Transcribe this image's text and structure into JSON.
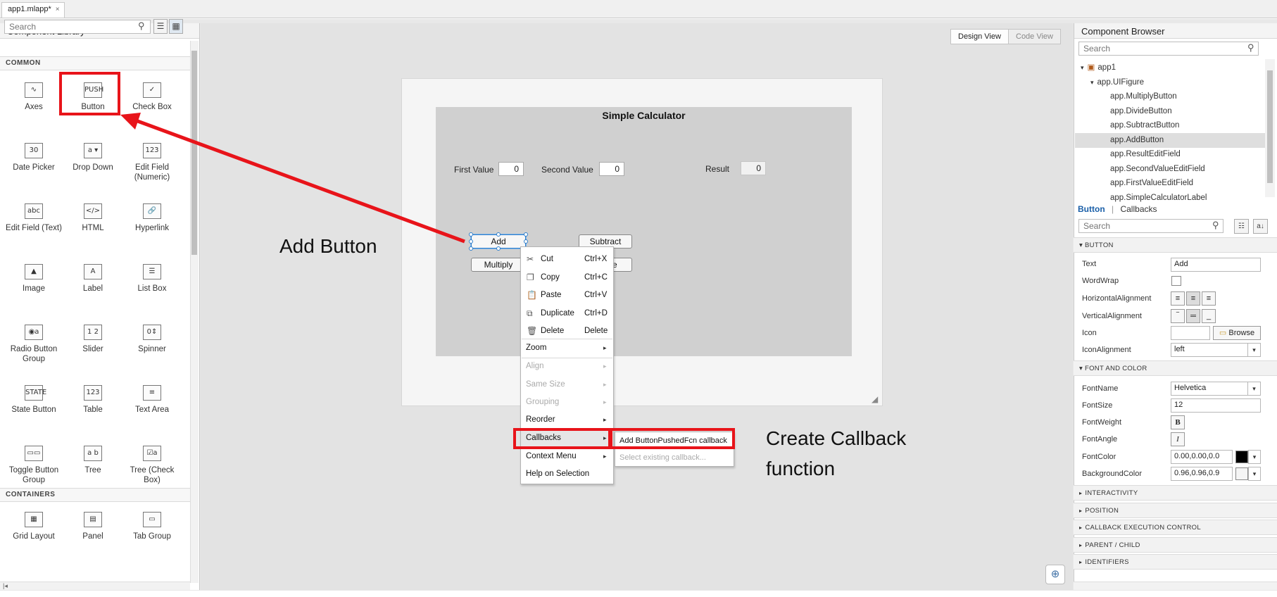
{
  "tab": {
    "label": "app1.mlapp*",
    "close": "×"
  },
  "library": {
    "title": "Component Library",
    "search_placeholder": "Search",
    "sections": {
      "common": "COMMON",
      "containers": "CONTAINERS"
    },
    "common": [
      {
        "label": "Axes",
        "icon": "∿",
        "icon_name": "axes-icon"
      },
      {
        "label": "Button",
        "icon": "PUSH",
        "icon_name": "push-button-icon"
      },
      {
        "label": "Check Box",
        "icon": "✓",
        "icon_name": "checkbox-icon"
      },
      {
        "label": "Date Picker",
        "icon": "30",
        "icon_name": "calendar-icon"
      },
      {
        "label": "Drop Down",
        "icon": "a ▾",
        "icon_name": "dropdown-icon"
      },
      {
        "label": "Edit Field (Numeric)",
        "icon": "123",
        "icon_name": "numeric-field-icon"
      },
      {
        "label": "Edit Field (Text)",
        "icon": "abc",
        "icon_name": "text-field-icon"
      },
      {
        "label": "HTML",
        "icon": "</>",
        "icon_name": "html-icon"
      },
      {
        "label": "Hyperlink",
        "icon": "🔗",
        "icon_name": "hyperlink-icon"
      },
      {
        "label": "Image",
        "icon": "▲",
        "icon_name": "image-icon"
      },
      {
        "label": "Label",
        "icon": "A",
        "icon_name": "label-icon"
      },
      {
        "label": "List Box",
        "icon": "☰",
        "icon_name": "listbox-icon"
      },
      {
        "label": "Radio Button Group",
        "icon": "◉a",
        "icon_name": "radio-group-icon"
      },
      {
        "label": "Slider",
        "icon": "1 2",
        "icon_name": "slider-icon"
      },
      {
        "label": "Spinner",
        "icon": "0⇕",
        "icon_name": "spinner-icon"
      },
      {
        "label": "State Button",
        "icon": "STATE",
        "icon_name": "state-button-icon"
      },
      {
        "label": "Table",
        "icon": "123",
        "icon_name": "table-icon"
      },
      {
        "label": "Text Area",
        "icon": "≡",
        "icon_name": "textarea-icon"
      },
      {
        "label": "Toggle Button Group",
        "icon": "▭▭",
        "icon_name": "toggle-group-icon"
      },
      {
        "label": "Tree",
        "icon": "a b",
        "icon_name": "tree-icon"
      },
      {
        "label": "Tree (Check Box)",
        "icon": "☑a",
        "icon_name": "tree-checkbox-icon"
      }
    ],
    "containers": [
      {
        "label": "Grid Layout",
        "icon": "▦",
        "icon_name": "grid-layout-icon"
      },
      {
        "label": "Panel",
        "icon": "▤",
        "icon_name": "panel-icon"
      },
      {
        "label": "Tab Group",
        "icon": "▭",
        "icon_name": "tab-group-icon"
      }
    ]
  },
  "canvas": {
    "design_view": "Design View",
    "code_view": "Code View",
    "figure": {
      "title": "Simple Calculator",
      "first_label": "First Value",
      "first_value": "0",
      "second_label": "Second Value",
      "second_value": "0",
      "result_label": "Result",
      "result_value": "0",
      "buttons": {
        "add": "Add",
        "subtract": "Subtract",
        "multiply": "Multiply",
        "divide": "Divide"
      }
    }
  },
  "context_menu": {
    "items": [
      {
        "label": "Cut",
        "shortcut": "Ctrl+X",
        "icon": "✂"
      },
      {
        "label": "Copy",
        "shortcut": "Ctrl+C",
        "icon": "❐"
      },
      {
        "label": "Paste",
        "shortcut": "Ctrl+V",
        "icon": "📋"
      },
      {
        "label": "Duplicate",
        "shortcut": "Ctrl+D",
        "icon": "⧉"
      },
      {
        "label": "Delete",
        "shortcut": "Delete",
        "icon": "🗑"
      }
    ],
    "zoom": "Zoom",
    "align": "Align",
    "same_size": "Same Size",
    "grouping": "Grouping",
    "reorder": "Reorder",
    "callbacks": "Callbacks",
    "context_menu": "Context Menu",
    "help": "Help on Selection",
    "submenu": {
      "add": "Add ButtonPushedFcn callback",
      "select": "Select existing callback..."
    }
  },
  "annotations": {
    "add_button": "Add Button",
    "create_callback_1": "Create Callback",
    "create_callback_2": "function"
  },
  "browser": {
    "title": "Component Browser",
    "search_placeholder": "Search",
    "tree": [
      {
        "label": "app1",
        "level": 0
      },
      {
        "label": "app.UIFigure",
        "level": 1
      },
      {
        "label": "app.MultiplyButton",
        "level": 2
      },
      {
        "label": "app.DivideButton",
        "level": 2
      },
      {
        "label": "app.SubtractButton",
        "level": 2
      },
      {
        "label": "app.AddButton",
        "level": 2,
        "selected": true
      },
      {
        "label": "app.ResultEditField",
        "level": 2
      },
      {
        "label": "app.SecondValueEditField",
        "level": 2
      },
      {
        "label": "app.FirstValueEditField",
        "level": 2
      },
      {
        "label": "app.SimpleCalculatorLabel",
        "level": 2
      }
    ]
  },
  "inspector": {
    "tab_button": "Button",
    "tab_callbacks": "Callbacks",
    "search_placeholder": "Search",
    "button_section": "BUTTON",
    "font_section": "FONT AND COLOR",
    "props": {
      "text_label": "Text",
      "text_value": "Add",
      "wordwrap_label": "WordWrap",
      "halign_label": "HorizontalAlignment",
      "valign_label": "VerticalAlignment",
      "icon_label": "Icon",
      "browse": "Browse",
      "iconalign_label": "IconAlignment",
      "iconalign_value": "left",
      "fontname_label": "FontName",
      "fontname_value": "Helvetica",
      "fontsize_label": "FontSize",
      "fontsize_value": "12",
      "fontweight_label": "FontWeight",
      "bold": "B",
      "fontangle_label": "FontAngle",
      "italic": "I",
      "fontcolor_label": "FontColor",
      "fontcolor_value": "0.00,0.00,0.0",
      "bgcolor_label": "BackgroundColor",
      "bgcolor_value": "0.96,0.96,0.9"
    },
    "collapsed": [
      "INTERACTIVITY",
      "POSITION",
      "CALLBACK EXECUTION CONTROL",
      "PARENT / CHILD",
      "IDENTIFIERS"
    ]
  },
  "colors": {
    "highlight_red": "#e8141a",
    "selection_blue": "#2f7fcc",
    "panel_gray": "#d0d0d0"
  }
}
